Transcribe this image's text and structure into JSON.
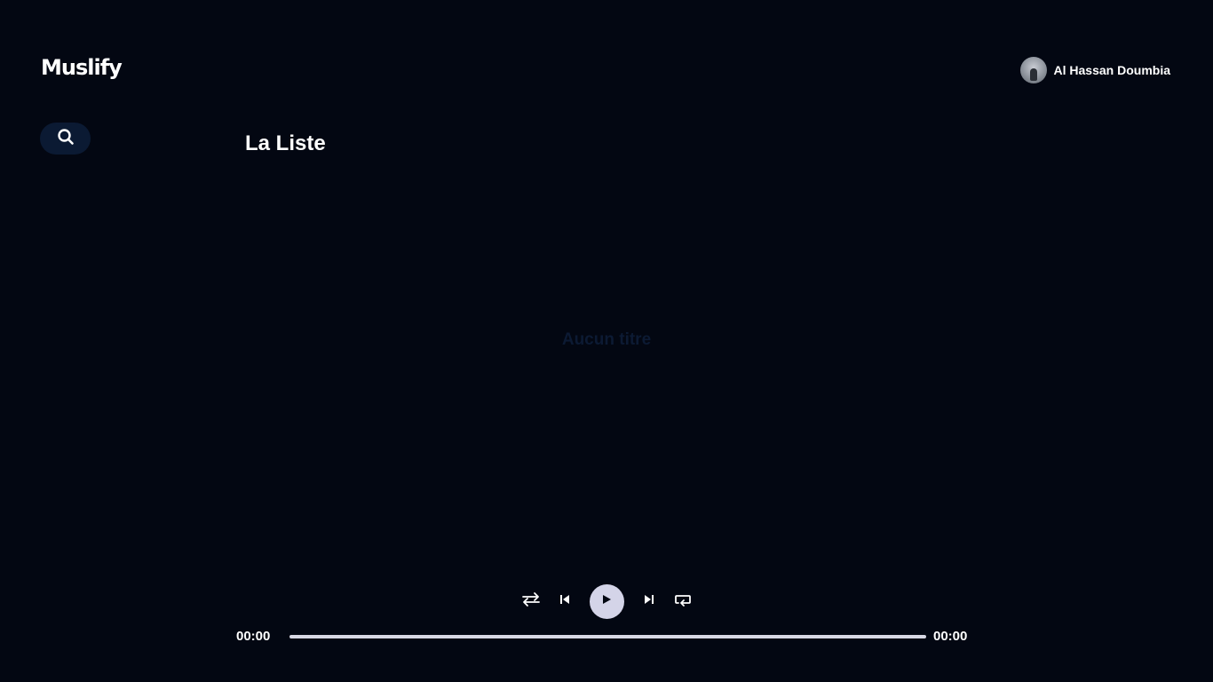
{
  "app": {
    "logo": "Muslify"
  },
  "user": {
    "name": "Al Hassan Doumbia",
    "avatar_icon": "user-avatar"
  },
  "sidebar": {
    "search_icon": "search-icon"
  },
  "main": {
    "title": "La Liste",
    "empty_message": "Aucun titre"
  },
  "player": {
    "current_time": "00:00",
    "duration": "00:00",
    "progress": 0,
    "controls": [
      "shuffle-icon",
      "previous-icon",
      "play-icon",
      "next-icon",
      "repeat-icon"
    ]
  },
  "colors": {
    "background": "#030712",
    "search_button": "#0b1a33",
    "play_button": "#d4d4e8",
    "empty_text": "#0c1a33"
  }
}
